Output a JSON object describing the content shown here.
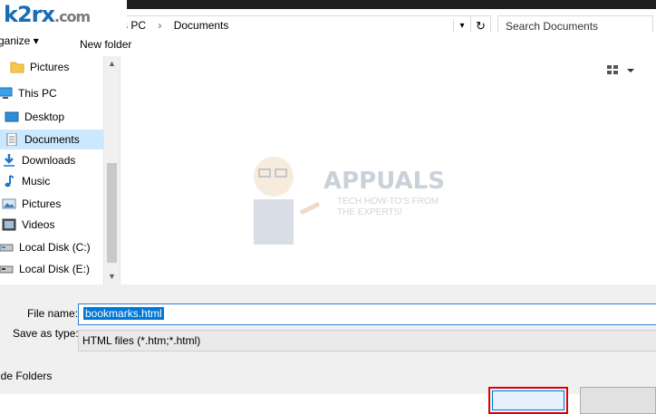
{
  "logo": {
    "text": "k2rx",
    "tld": ".com"
  },
  "address": {
    "crumbs": [
      "s PC",
      "Documents"
    ],
    "separator": "›"
  },
  "search": {
    "placeholder": "Search Documents"
  },
  "cmdbar": {
    "organize": "rganize ▾",
    "new_folder": "New folder"
  },
  "sidebar": {
    "items": [
      {
        "label": "Pictures",
        "icon": "folder-icon"
      },
      {
        "label": "This PC",
        "icon": "computer-icon"
      },
      {
        "label": "Desktop",
        "icon": "desktop-icon"
      },
      {
        "label": "Documents",
        "icon": "documents-icon"
      },
      {
        "label": "Downloads",
        "icon": "download-icon"
      },
      {
        "label": "Music",
        "icon": "music-icon"
      },
      {
        "label": "Pictures",
        "icon": "pictures-icon"
      },
      {
        "label": "Videos",
        "icon": "videos-icon"
      },
      {
        "label": "Local Disk (C:)",
        "icon": "disk-icon"
      },
      {
        "label": "Local Disk (E:)",
        "icon": "disk-icon"
      }
    ]
  },
  "watermark": {
    "title": "APPUALS",
    "tagline1": "TECH HOW-TO'S FROM",
    "tagline2": "THE EXPERTS!"
  },
  "form": {
    "file_name_label": "File name:",
    "file_name_value": "bookmarks.html",
    "save_type_label": "Save as type:",
    "save_type_value": "HTML files (*.htm;*.html)"
  },
  "footer": {
    "hide_folders": "ide Folders"
  },
  "colors": {
    "accent": "#0078d7",
    "highlight": "#e00000",
    "selected_bg": "#cce8ff"
  }
}
